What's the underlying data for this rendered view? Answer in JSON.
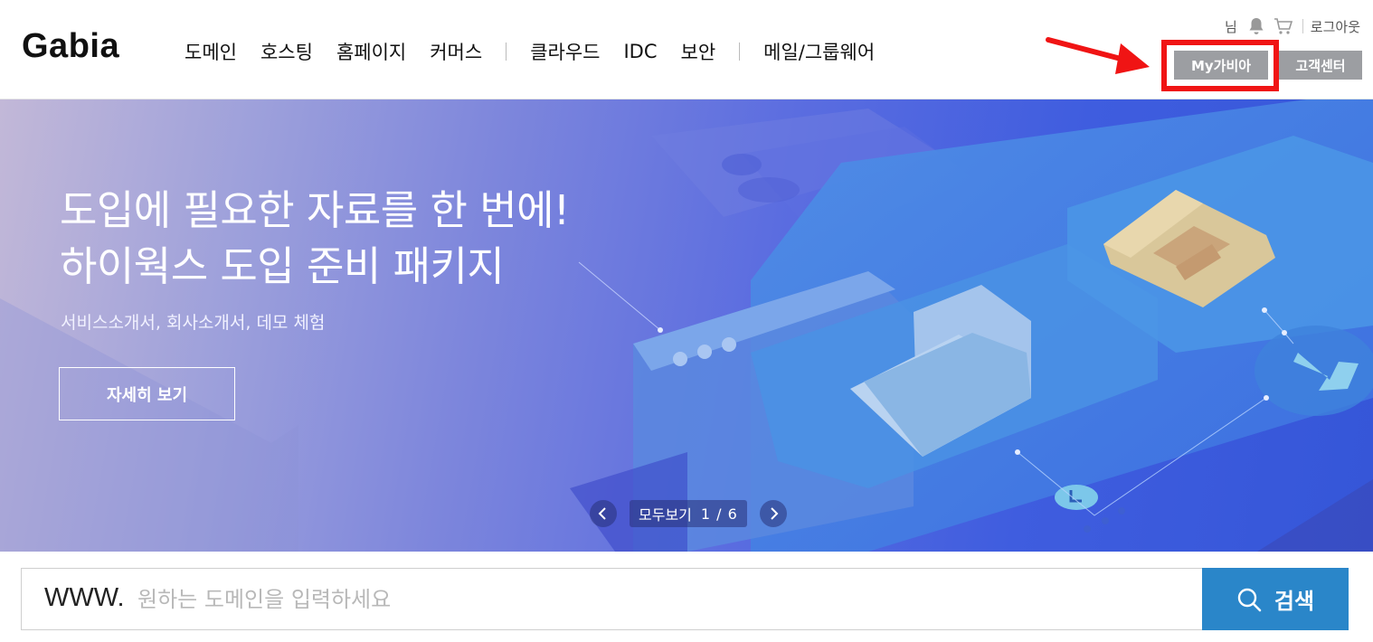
{
  "header": {
    "logo": "Gabia",
    "nav": [
      "도메인",
      "호스팅",
      "홈페이지",
      "커머스",
      "클라우드",
      "IDC",
      "보안",
      "메일/그룹웨어"
    ],
    "util": {
      "user": "님",
      "bell_icon": "bell-icon",
      "cart_icon": "cart-icon",
      "logout": "로그아웃"
    },
    "my_gabia": "My가비아",
    "customer_center": "고객센터",
    "highlight_color": "#f01414"
  },
  "hero": {
    "title_line1": "도입에 필요한 자료를 한 번에!",
    "title_line2": "하이웍스 도입 준비 패키지",
    "subtitle": "서비스소개서, 회사소개서, 데모 체험",
    "more_button": "자세히 보기",
    "pager": {
      "view_all": "모두보기",
      "count": "1 / 6",
      "prev_icon": "chevron-left-icon",
      "next_icon": "chevron-right-icon"
    }
  },
  "search": {
    "prefix": "WWW.",
    "placeholder": "원하는 도메인을 입력하세요",
    "value": "",
    "button": "검색",
    "button_color": "#2a86c9"
  }
}
